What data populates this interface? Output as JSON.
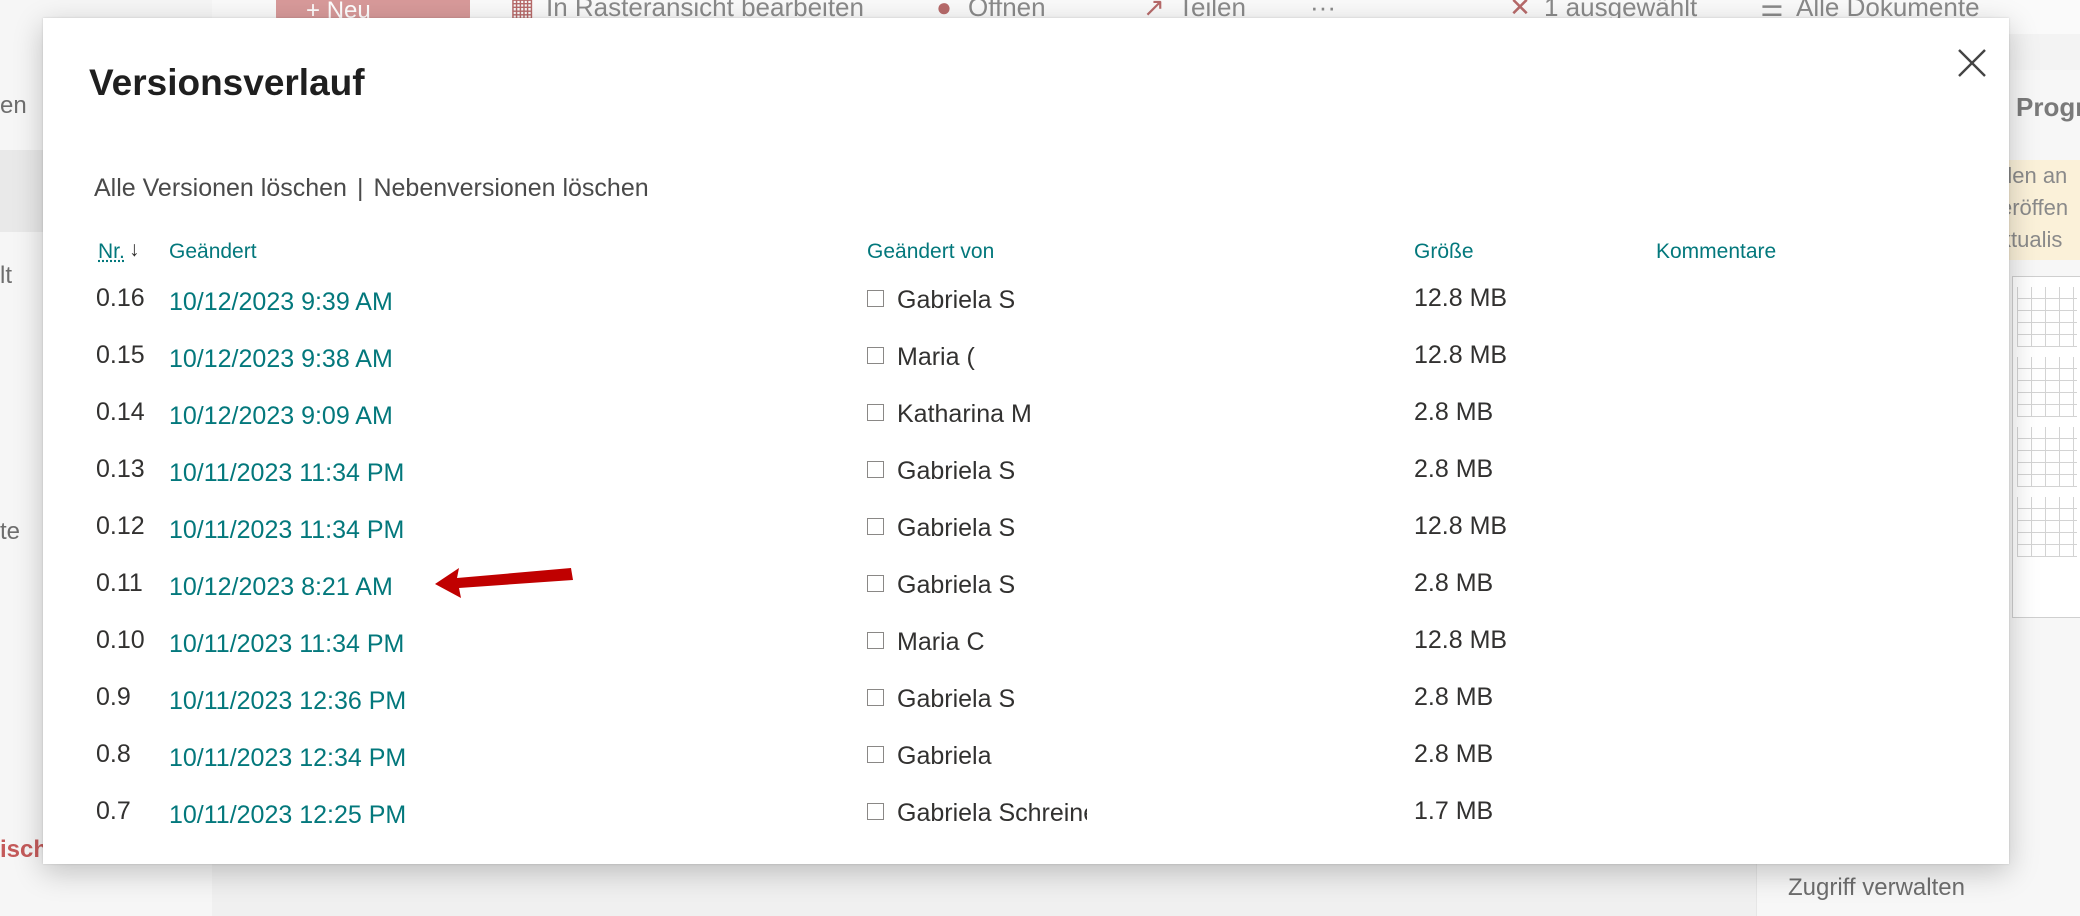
{
  "background": {
    "left_rail": [
      "en",
      "lt",
      "te",
      "isch"
    ],
    "toolbar": {
      "new_label": "Neu",
      "grid_view_label": "In Rasteransicht bearbeiten",
      "open_label": "Öffnen",
      "share_label": "Teilen",
      "more_label": "···",
      "selected_label": "1 ausgewählt",
      "view_label": "Alle Dokumente"
    },
    "details_pane": {
      "title": "Progr",
      "notice_lines": [
        "den an",
        "eröffen",
        "ktualis"
      ],
      "manage_access_label": "Zugriff verwalten"
    }
  },
  "dialog": {
    "title": "Versionsverlauf",
    "delete_all_label": "Alle Versionen löschen",
    "separator": "|",
    "delete_minor_label": "Nebenversionen löschen",
    "columns": {
      "number": "Nr.",
      "changed": "Geändert",
      "changed_by": "Geändert von",
      "size": "Größe",
      "comments": "Kommentare"
    },
    "sort_icon": "arrow-down-icon",
    "close_icon": "close-icon",
    "versions": [
      {
        "number": "0.16",
        "changed": "10/12/2023 9:39 AM",
        "changed_by": "Gabriela S",
        "size": "12.8 MB"
      },
      {
        "number": "0.15",
        "changed": "10/12/2023 9:38 AM",
        "changed_by": "Maria (",
        "size": "12.8 MB"
      },
      {
        "number": "0.14",
        "changed": "10/12/2023 9:09 AM",
        "changed_by": "Katharina M",
        "size": "2.8 MB"
      },
      {
        "number": "0.13",
        "changed": "10/11/2023 11:34 PM",
        "changed_by": "Gabriela S",
        "size": "2.8 MB"
      },
      {
        "number": "0.12",
        "changed": "10/11/2023 11:34 PM",
        "changed_by": "Gabriela S",
        "size": "12.8 MB"
      },
      {
        "number": "0.11",
        "changed": "10/12/2023 8:21 AM",
        "changed_by": "Gabriela S",
        "size": "2.8 MB"
      },
      {
        "number": "0.10",
        "changed": "10/11/2023 11:34 PM",
        "changed_by": "Maria C",
        "size": "12.8 MB"
      },
      {
        "number": "0.9",
        "changed": "10/11/2023 12:36 PM",
        "changed_by": "Gabriela S",
        "size": "2.8 MB"
      },
      {
        "number": "0.8",
        "changed": "10/11/2023 12:34 PM",
        "changed_by": "Gabriela",
        "size": "2.8 MB"
      },
      {
        "number": "0.7",
        "changed": "10/11/2023 12:25 PM",
        "changed_by": "Gabriela Schreiner",
        "size": "1.7 MB"
      }
    ],
    "annotation": {
      "icon": "red-arrow-icon",
      "color": "#c00000"
    }
  }
}
